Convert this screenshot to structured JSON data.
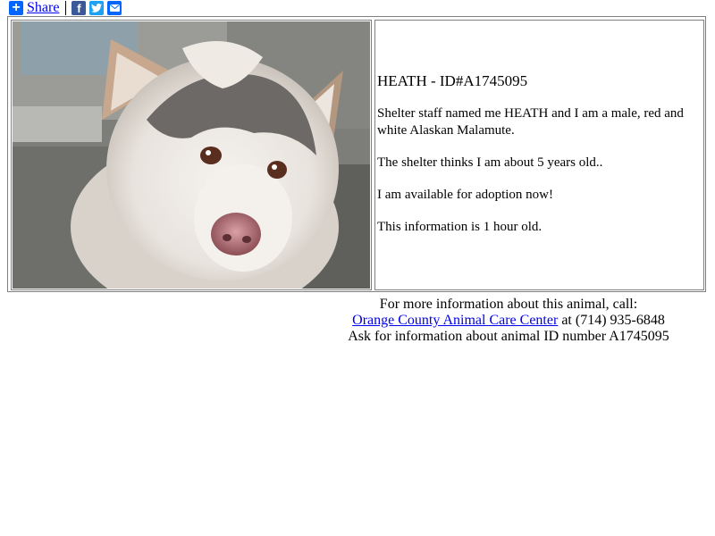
{
  "share_bar": {
    "share_label": "Share",
    "icons": [
      "plus-icon",
      "facebook-icon",
      "twitter-icon",
      "email-icon"
    ]
  },
  "animal": {
    "heading": "HEATH - ID#A1745095",
    "paragraphs": [
      "Shelter staff named me HEATH and I am a male, red and white Alaskan Malamute.",
      "The shelter thinks I am about 5 years old..",
      "I am available for adoption now!",
      "This information is 1 hour old."
    ]
  },
  "footer": {
    "line1": "For more information about this animal, call:",
    "shelter_name": "Orange County Animal Care Center",
    "phone_text": " at (714) 935-6848",
    "line3": "Ask for information about animal ID number A1745095"
  },
  "colors": {
    "link": "#0000ee",
    "share_blue": "#0166ff",
    "facebook": "#3b5998",
    "twitter": "#1da1f2",
    "border": "#808080"
  }
}
